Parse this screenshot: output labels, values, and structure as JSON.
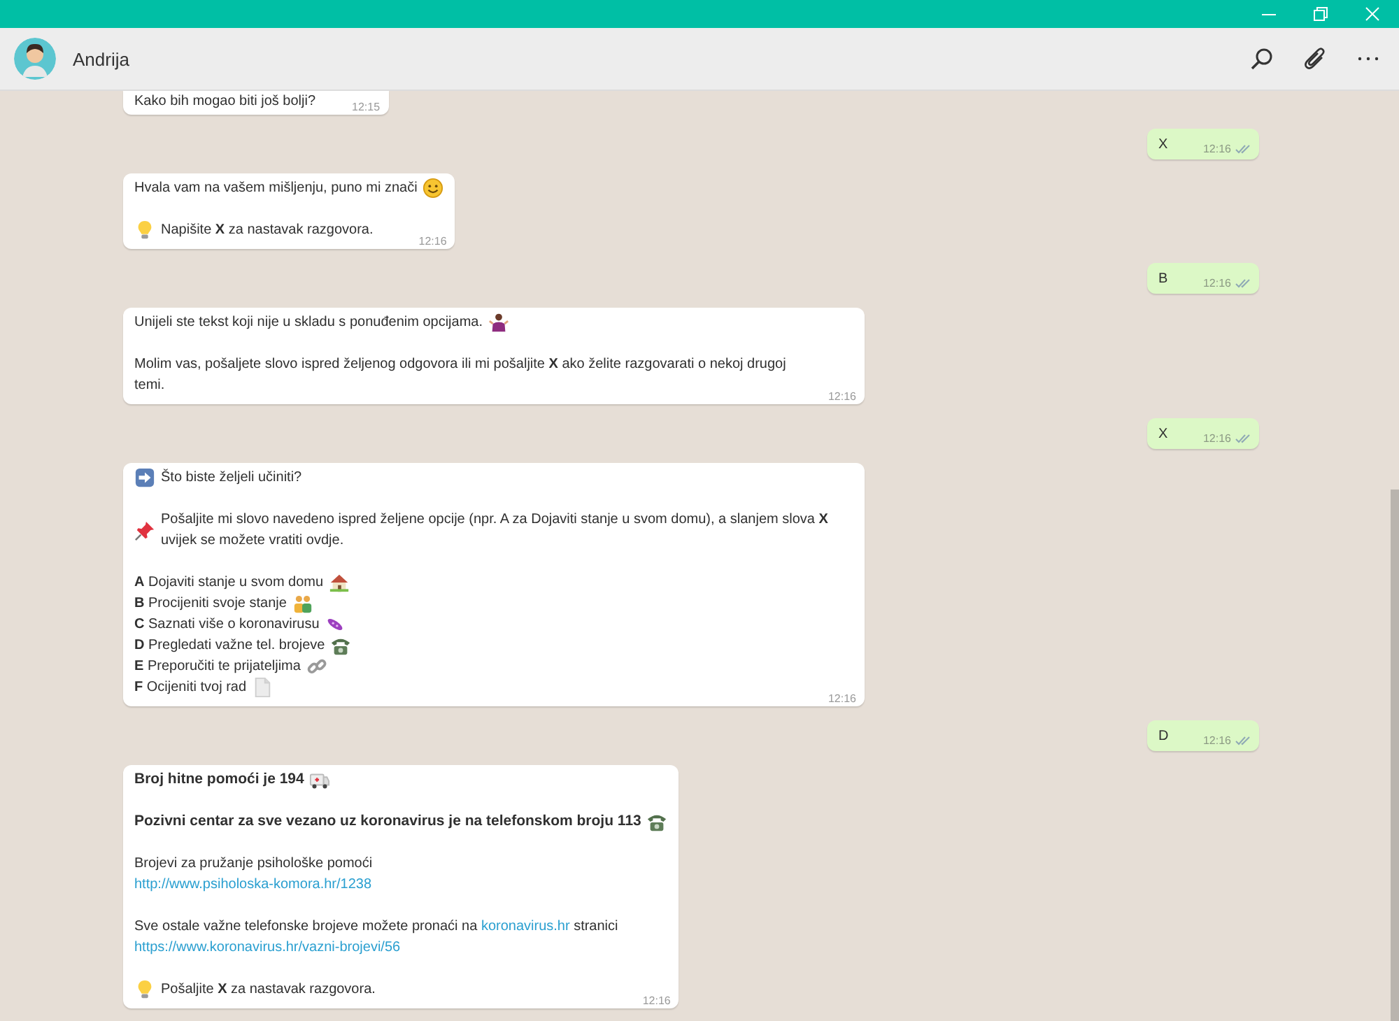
{
  "contact": {
    "name": "Andrija"
  },
  "messages": [
    {
      "kind": "incoming",
      "time": "12:15",
      "blocks": [
        [
          {
            "kind": "body",
            "segments": [
              {
                "kind": "text",
                "text": "Kako bih mogao biti još bolji?"
              }
            ]
          }
        ]
      ]
    },
    {
      "kind": "outgoing",
      "text": "X",
      "time": "12:16"
    },
    {
      "kind": "incoming",
      "time": "12:16",
      "blocks": [
        [
          {
            "kind": "body",
            "segments": [
              {
                "kind": "text",
                "text": "Hvala vam na vašem mišljenju, puno mi znači"
              },
              {
                "kind": "smile"
              }
            ]
          }
        ],
        [
          {
            "kind": "body",
            "segments": [
              {
                "kind": "bulb"
              },
              {
                "kind": "text",
                "text": "Napišite **X** za nastavak razgovora."
              }
            ]
          }
        ]
      ]
    },
    {
      "kind": "outgoing",
      "text": "B",
      "time": "12:16"
    },
    {
      "kind": "incoming",
      "time": "12:16",
      "blocks": [
        [
          {
            "kind": "body",
            "segments": [
              {
                "kind": "text",
                "text": "Unijeli ste tekst koji nije u skladu s ponuđenim opcijama."
              },
              {
                "kind": "shrug"
              }
            ]
          }
        ],
        [
          {
            "kind": "body",
            "segments": [
              {
                "kind": "text",
                "text": "Molim vas, pošaljete slovo ispred željenog odgovora ili mi pošaljite **X** ako želite razgovarati o nekoj drugoj temi."
              }
            ]
          }
        ]
      ]
    },
    {
      "kind": "outgoing",
      "text": "X",
      "time": "12:16"
    },
    {
      "kind": "incoming",
      "time": "12:16",
      "blocks": [
        [
          {
            "kind": "body",
            "segments": [
              {
                "kind": "arrow"
              },
              {
                "kind": "text",
                "text": "Što biste željeli učiniti?"
              }
            ]
          }
        ],
        [
          {
            "kind": "body",
            "segments": [
              {
                "kind": "pin"
              },
              {
                "kind": "text",
                "text": "Pošaljite mi slovo navedeno ispred željene opcije (npr. A za Dojaviti stanje u svom domu), a slanjem slova **X** uvijek se možete vratiti ovdje."
              }
            ]
          }
        ],
        [
          {
            "kind": "body",
            "segments": [
              {
                "kind": "text",
                "text": "**A** Dojaviti stanje u svom domu"
              },
              {
                "kind": "house"
              }
            ]
          },
          {
            "kind": "body",
            "segments": [
              {
                "kind": "text",
                "text": "**B** Procijeniti svoje stanje"
              },
              {
                "kind": "people"
              }
            ]
          },
          {
            "kind": "body",
            "segments": [
              {
                "kind": "text",
                "text": "**C** Saznati više o koronavirusu"
              },
              {
                "kind": "microbe"
              }
            ]
          },
          {
            "kind": "body",
            "segments": [
              {
                "kind": "text",
                "text": "**D** Pregledati važne tel. brojeve"
              },
              {
                "kind": "phone"
              }
            ]
          },
          {
            "kind": "body",
            "segments": [
              {
                "kind": "text",
                "text": "**E** Preporučiti te prijateljima"
              },
              {
                "kind": "link_icon"
              }
            ]
          },
          {
            "kind": "body",
            "segments": [
              {
                "kind": "text",
                "text": "**F** Ocijeniti tvoj rad"
              },
              {
                "kind": "document"
              }
            ]
          }
        ]
      ]
    },
    {
      "kind": "outgoing",
      "text": "D",
      "time": "12:16"
    },
    {
      "kind": "incoming",
      "time": "12:16",
      "blocks": [
        [
          {
            "kind": "heading",
            "segments": [
              {
                "kind": "text",
                "text": "Broj hitne pomoći je 194"
              },
              {
                "kind": "ambulance"
              }
            ]
          }
        ],
        [
          {
            "kind": "heading",
            "segments": [
              {
                "kind": "text",
                "text": "Pozivni centar za sve vezano uz koronavirus je na telefonskom broju 113"
              },
              {
                "kind": "phone"
              }
            ]
          }
        ],
        [
          {
            "kind": "body",
            "segments": [
              {
                "kind": "text",
                "text": "Brojevi za pružanje psihološke pomoći"
              }
            ]
          },
          {
            "kind": "body",
            "segments": [
              {
                "kind": "link",
                "text": "http://www.psiholoska-komora.hr/1238"
              }
            ]
          }
        ],
        [
          {
            "kind": "body",
            "segments": [
              {
                "kind": "text",
                "text": "Sve ostale važne telefonske brojeve možete pronaći na "
              },
              {
                "kind": "link",
                "text": "koronavirus.hr"
              },
              {
                "kind": "text",
                "text": " stranici"
              }
            ]
          },
          {
            "kind": "body",
            "segments": [
              {
                "kind": "link",
                "text": "https://www.koronavirus.hr/vazni-brojevi/56"
              }
            ]
          }
        ],
        [
          {
            "kind": "body",
            "segments": [
              {
                "kind": "bulb"
              },
              {
                "kind": "text",
                "text": "Pošaljite **X** za nastavak razgovora."
              }
            ]
          }
        ]
      ]
    }
  ]
}
